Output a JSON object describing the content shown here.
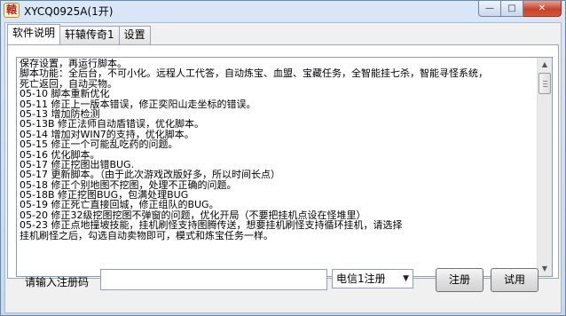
{
  "window": {
    "title": "XYCQ0925A(1开)",
    "icon_glyph": "轅",
    "minimize_glyph": "—",
    "maximize_glyph": "□",
    "close_glyph": "✕"
  },
  "tabs": [
    {
      "label": "软件说明",
      "active": true
    },
    {
      "label": "轩辕传奇1",
      "active": false
    },
    {
      "label": "设置",
      "active": false
    }
  ],
  "notes": [
    "保存设置，再运行脚本。",
    "脚本功能：全后台，不可小化。远程人工代答，自动炼宝、血盟、宝藏任务，全智能挂七杀，智能寻怪系统，",
    "死亡返回，自动买物。",
    "05-10 脚本重新优化",
    "05-11 修正上一版本错误，修正奕阳山走坐标的错误。",
    "05-13 增加防检测",
    "05-13B 修正法师自动盾错误，优化脚本。",
    "05-14 增加对WIN7的支持，优化脚本。",
    "05-15 修正一个可能乱吃药的问题。",
    "05-16 优化脚本。",
    "05-17 修正挖图出错BUG.",
    "05-17 更新脚本。（由于此次游戏改版好多，所以时间长点）",
    "05-18 修正个别地图不挖图，处理不正确的问题。",
    "05-18B 修正挖图BUG，包满处理BUG",
    "05-19 修正死亡直接回城，修正组队的BUG。",
    "05-20 修正32级挖图挖图不弹窗的问题，优化开局（不要把挂机点设在怪堆里）",
    "05-23  修正点地撞坡技能，挂机刷怪支持图腾传送，想要挂机刷怪支持循环挂机，请选择",
    "       挂机刷怪之后，勾选自动卖物即可，模式和炼宝任务一样。"
  ],
  "scrollbar": {
    "up_glyph": "▲",
    "down_glyph": "▼"
  },
  "register": {
    "label": "请输入注册码",
    "code_value": "",
    "isp_selected": "电信1注册",
    "dropdown_glyph": "▼",
    "register_button": "注册",
    "trial_button": "试用"
  }
}
